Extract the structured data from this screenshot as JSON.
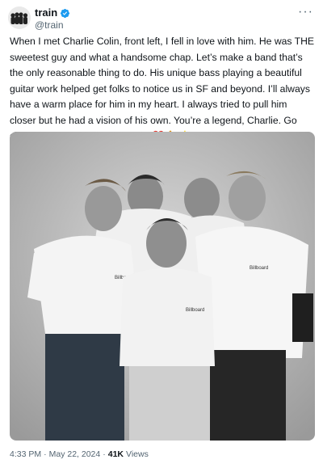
{
  "author": {
    "display_name": "train",
    "handle": "@train",
    "avatar_icon": "band-avatar-icon",
    "verified_icon": "verified-badge-icon",
    "verified_color": "#1d9bf0"
  },
  "more_icon": "more-options-icon",
  "tweet": {
    "text": "When I met Charlie Colin, front left, I fell in love with him. He was THE sweetest guy and what a handsome chap. Let’s make a band that’s the only reasonable thing to do. His unique bass playing a beautiful guitar work helped get folks to notice us in SF and beyond. I’ll always have a warm place for him in my heart. I always tried to pull him closer but he had a vision of his own. You’re a legend, Charlie. Go charm the pants off those angels",
    "emojis": [
      "❤️",
      "🙏",
      "⭐"
    ]
  },
  "media": {
    "photo_icon": "band-photo",
    "shirt_logo": "Billboard"
  },
  "meta": {
    "time": "4:33 PM",
    "sep1": "·",
    "date": "May 22, 2024",
    "sep2": "·",
    "views_count": "41K",
    "views_label": "Views"
  }
}
